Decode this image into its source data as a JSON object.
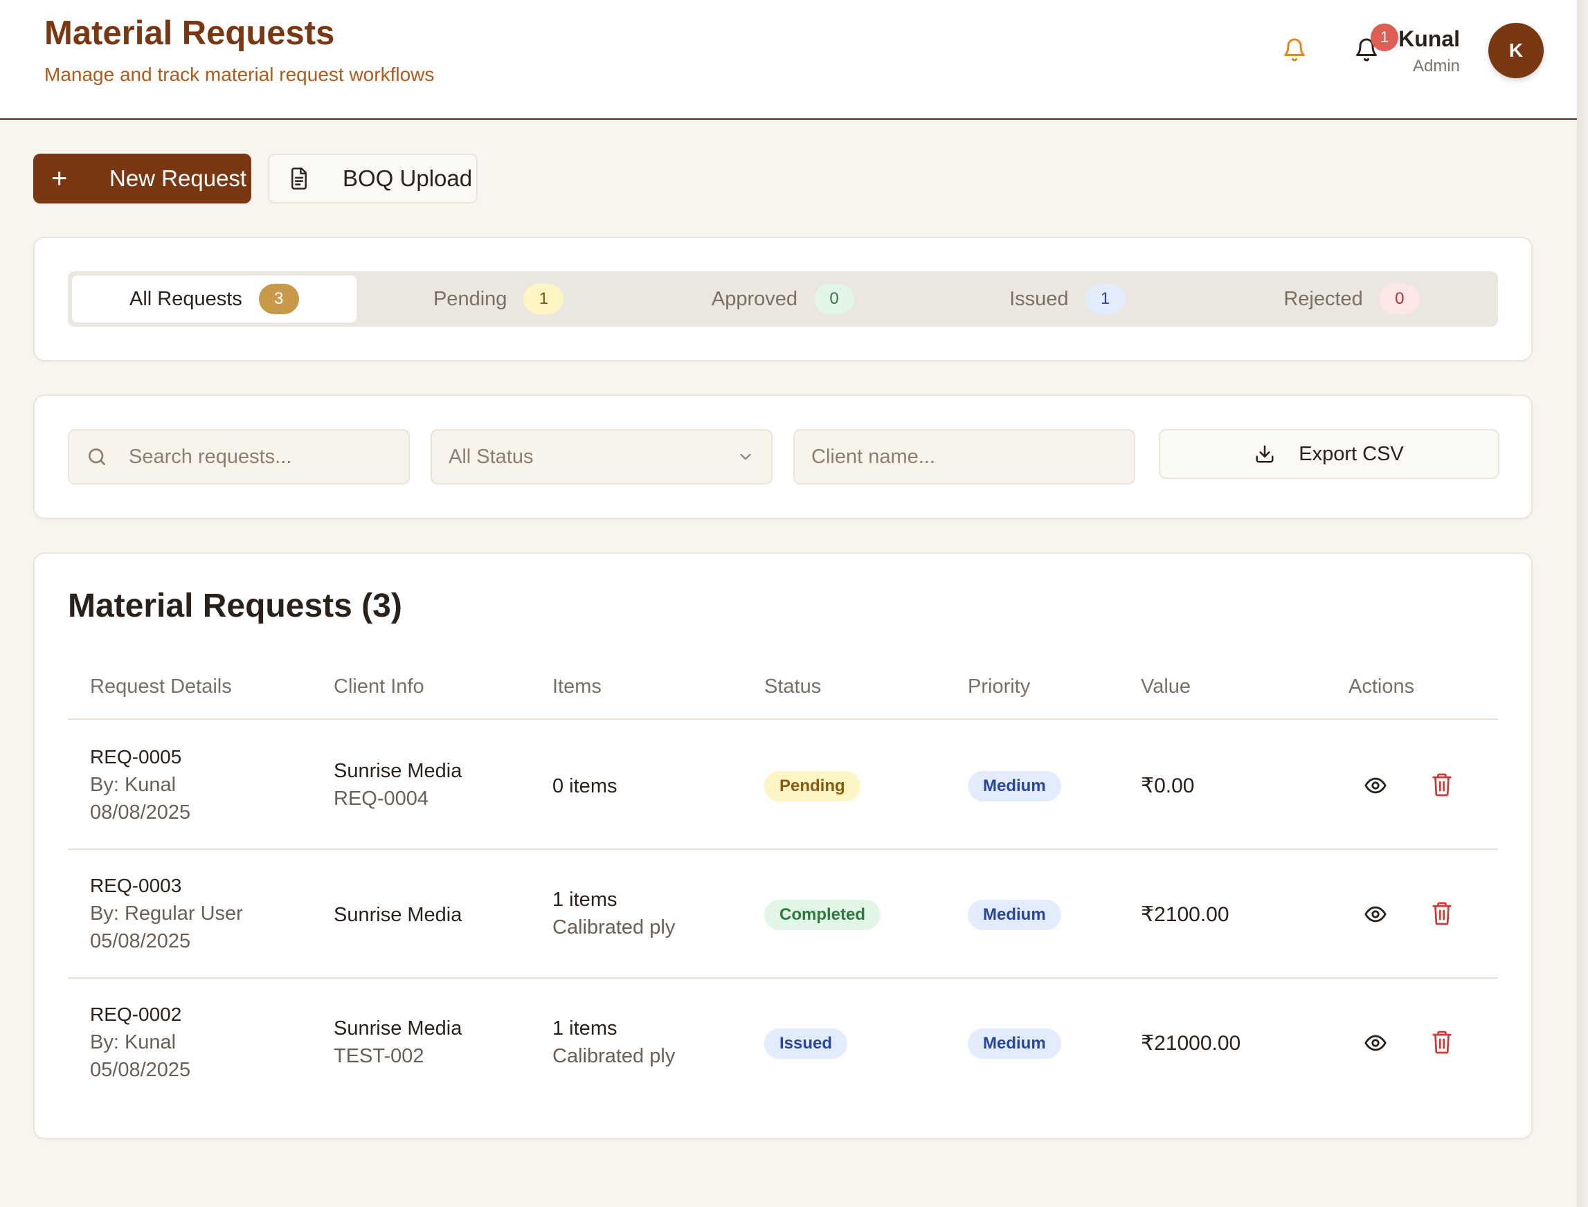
{
  "header": {
    "title": "Material Requests",
    "subtitle": "Manage and track material request workflows",
    "notification_count": "1",
    "user_name": "Kunal",
    "user_role": "Admin",
    "avatar_initial": "K"
  },
  "actions": {
    "new_request_label": "New Request",
    "boq_upload_label": "BOQ Upload"
  },
  "tabs": [
    {
      "label": "All Requests",
      "count": "3",
      "active": true
    },
    {
      "label": "Pending",
      "count": "1"
    },
    {
      "label": "Approved",
      "count": "0"
    },
    {
      "label": "Issued",
      "count": "1"
    },
    {
      "label": "Rejected",
      "count": "0"
    }
  ],
  "filters": {
    "search_placeholder": "Search requests...",
    "status_selected": "All Status",
    "client_placeholder": "Client name...",
    "export_label": "Export CSV"
  },
  "table": {
    "title": "Material Requests (3)",
    "columns": [
      "Request Details",
      "Client Info",
      "Items",
      "Status",
      "Priority",
      "Value",
      "Actions"
    ],
    "rows": [
      {
        "id": "REQ-0005",
        "by": "By: Kunal",
        "date": "08/08/2025",
        "client": "Sunrise Media",
        "client_ref": "REQ-0004",
        "items": "0 items",
        "items_detail": "",
        "status": "Pending",
        "priority": "Medium",
        "value": "₹0.00"
      },
      {
        "id": "REQ-0003",
        "by": "By: Regular User",
        "date": "05/08/2025",
        "client": "Sunrise Media",
        "client_ref": "",
        "items": "1 items",
        "items_detail": "Calibrated ply",
        "status": "Completed",
        "priority": "Medium",
        "value": "₹2100.00"
      },
      {
        "id": "REQ-0002",
        "by": "By: Kunal",
        "date": "05/08/2025",
        "client": "Sunrise Media",
        "client_ref": "TEST-002",
        "items": "1 items",
        "items_detail": "Calibrated ply",
        "status": "Issued",
        "priority": "Medium",
        "value": "₹21000.00"
      }
    ]
  },
  "colors": {
    "brand": "#7a3812",
    "accent": "#b25a1c",
    "background": "#f8f5ee",
    "delete": "#d03a36"
  }
}
